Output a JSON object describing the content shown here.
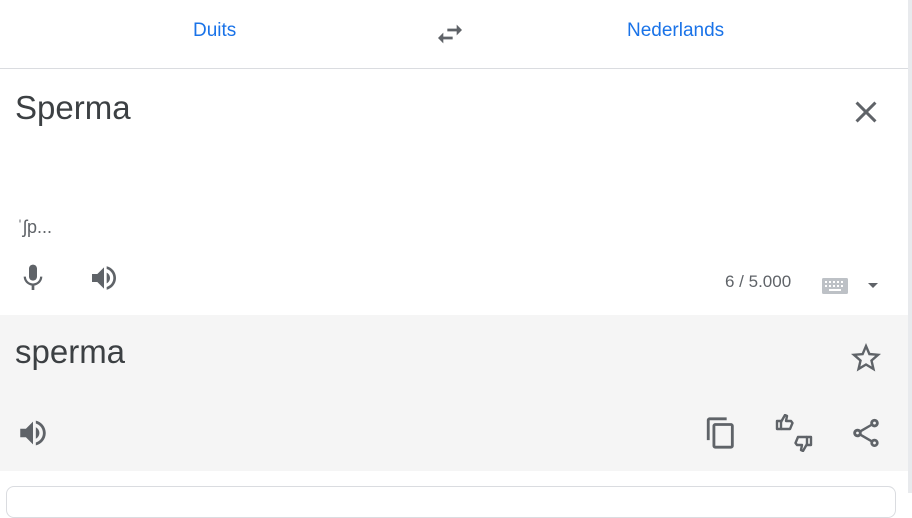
{
  "languages": {
    "source": "Duits",
    "target": "Nederlands",
    "swap_icon": "swap-horiz-icon"
  },
  "source": {
    "text": "Sperma",
    "transliteration": "ˈʃp...",
    "char_count": "6 / 5.000",
    "icons": {
      "clear": "close-icon",
      "mic": "microphone-icon",
      "speak": "volume-up-icon",
      "keyboard": "keyboard-icon",
      "dropdown": "arrow-drop-down-icon"
    }
  },
  "target": {
    "text": "sperma",
    "icons": {
      "star": "star-outline-icon",
      "speak": "volume-up-icon",
      "copy": "copy-icon",
      "feedback": "thumbs-up-down-icon",
      "share": "share-icon"
    }
  },
  "colors": {
    "accent": "#1a73e8",
    "icon": "#5f6368",
    "target_bg": "#f5f5f5",
    "divider": "#dadce0"
  }
}
